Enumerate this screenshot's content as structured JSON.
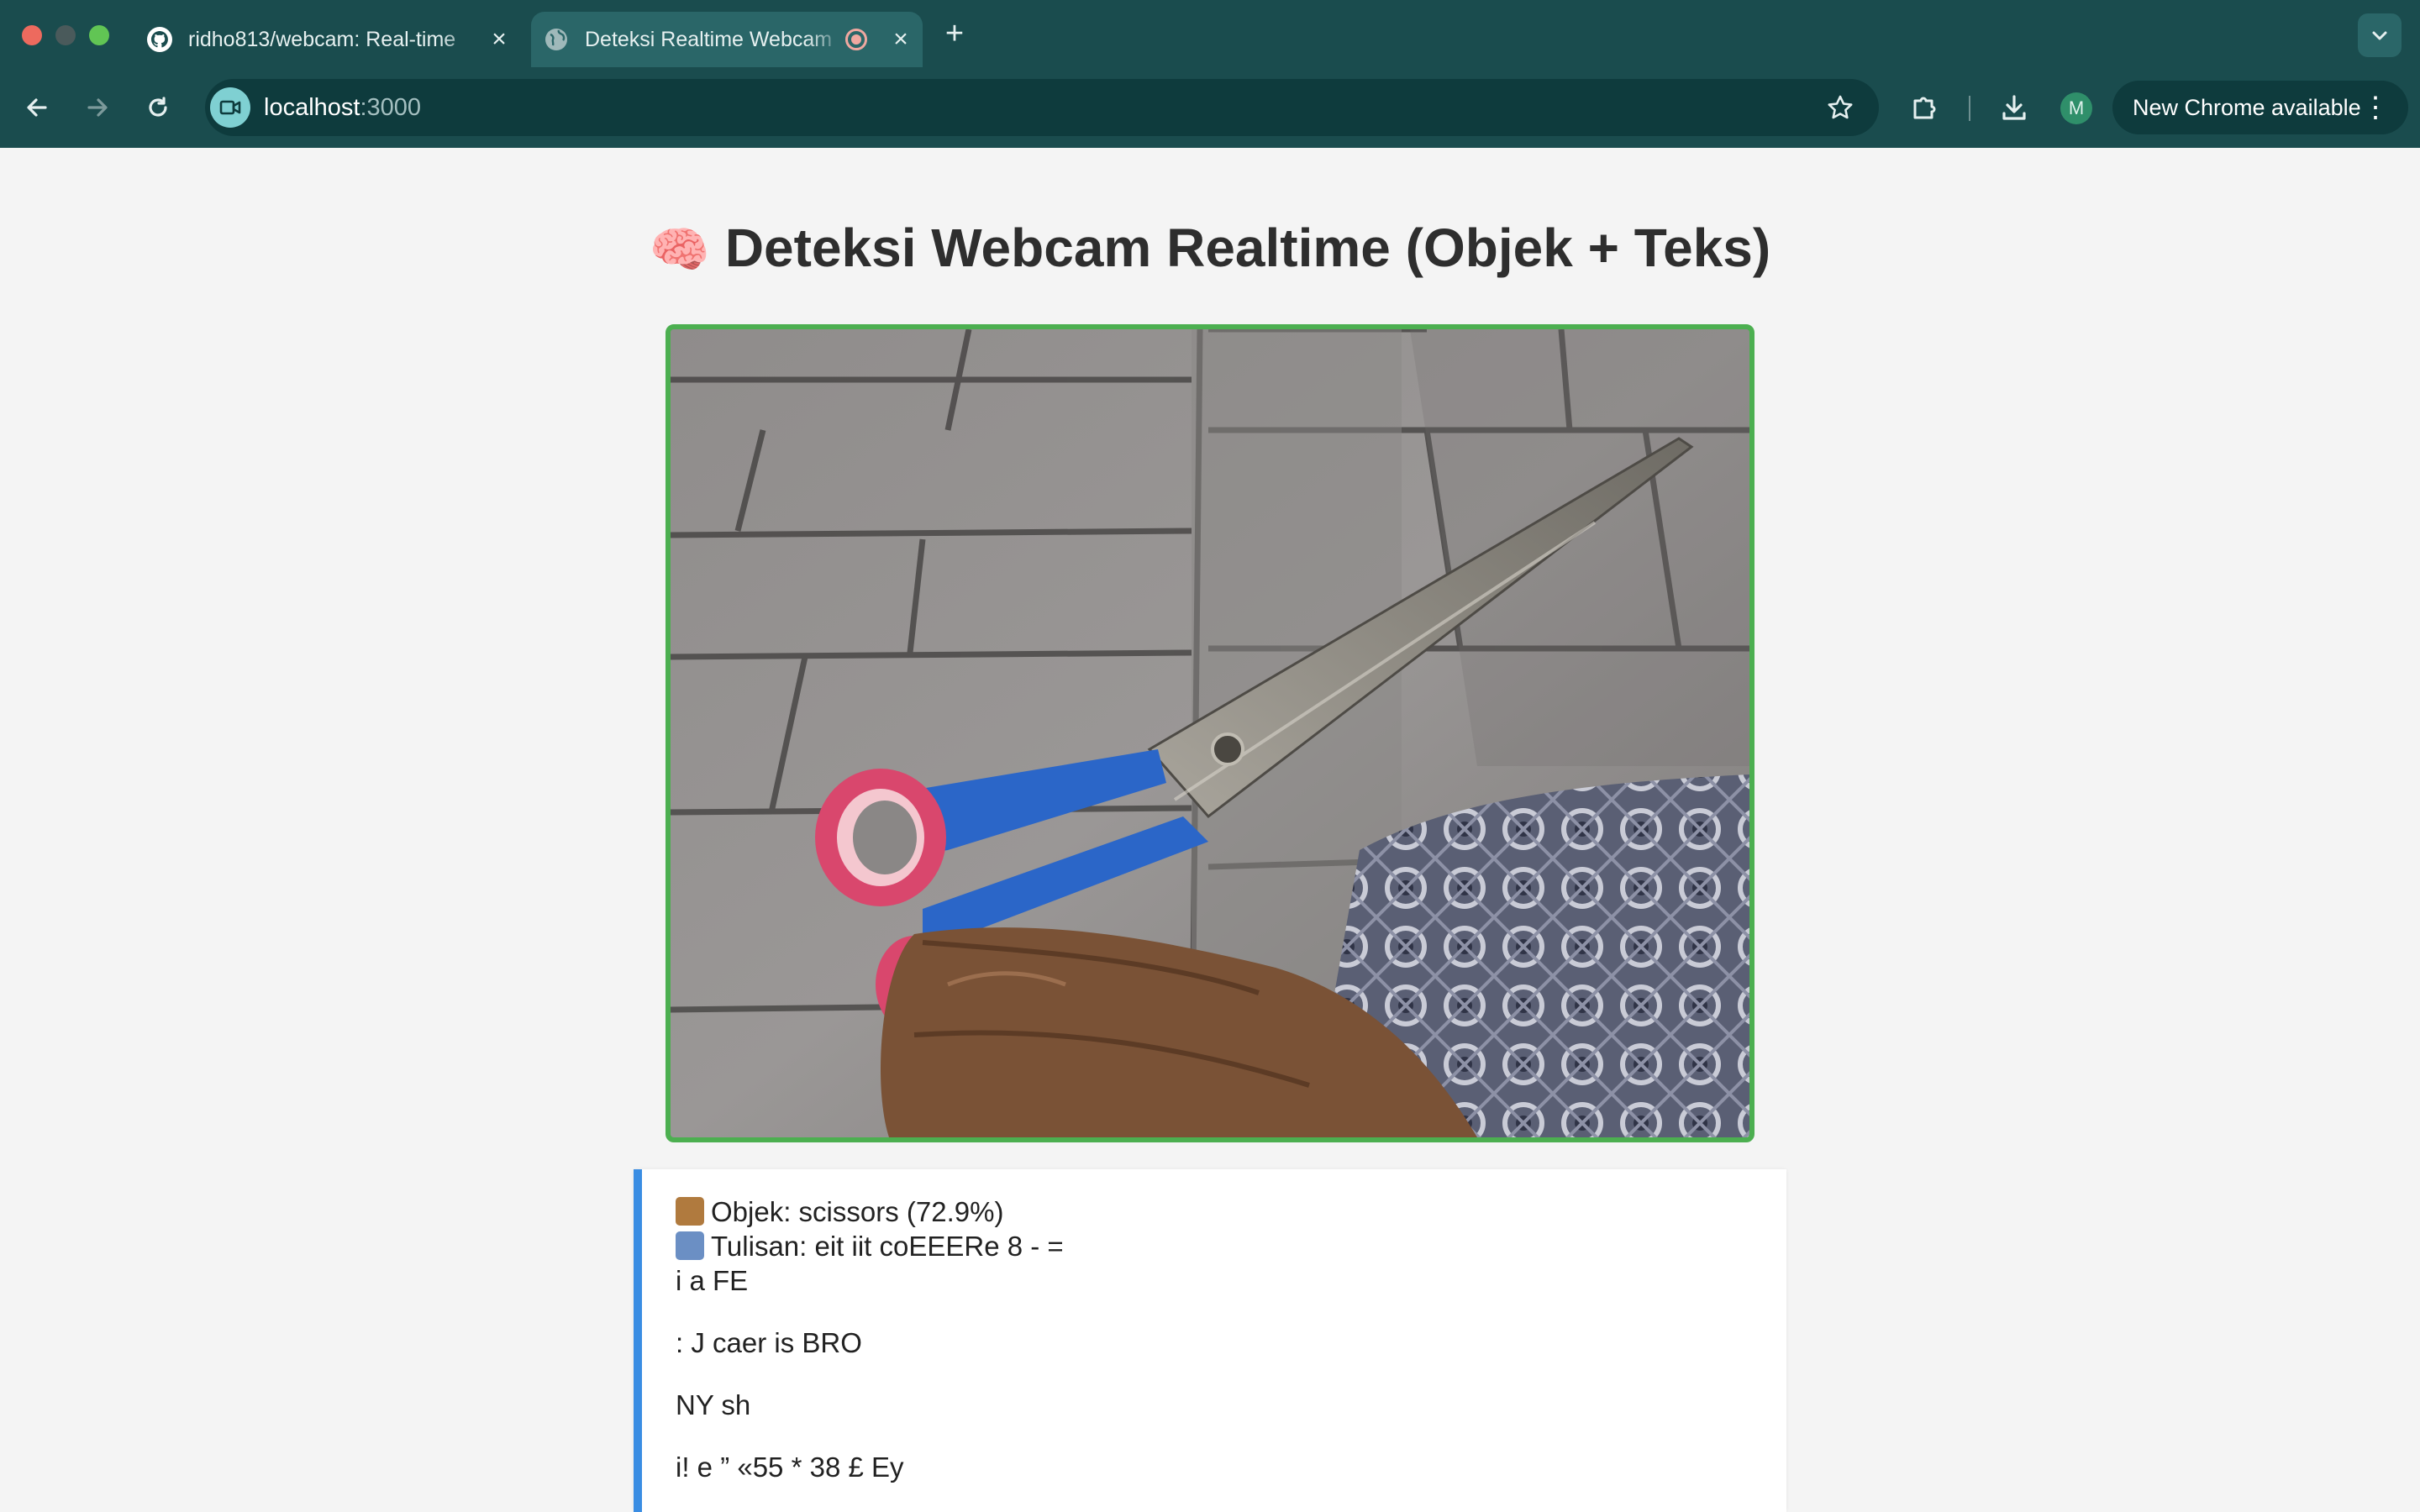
{
  "browser": {
    "tabs": [
      {
        "title": "ridho813/webcam: Real-time",
        "favicon": "github-icon",
        "active": false
      },
      {
        "title": "Deteksi Realtime Webcam",
        "favicon": "globe-icon",
        "active": true,
        "recording": true
      }
    ],
    "url_host": "localhost",
    "url_port": ":3000",
    "profile_initial": "M",
    "update_label": "New Chrome available",
    "colors": {
      "chrome": "#1a4c4e",
      "active_tab": "#2a6668",
      "omnibox": "#0e3b3d"
    }
  },
  "page": {
    "heading_emoji": "🧠",
    "heading": "Deteksi Webcam Realtime (Objek + Teks)",
    "video_border_color": "#4caf50",
    "result_accent": "#3a8de3",
    "results": {
      "object_line": "Objek: scissors (72.9%)",
      "text_label": "Tulisan: eit iit coEEERe 8 - =",
      "ocr_lines": [
        "i a FE",
        ": J caer is BRO",
        "NY sh",
        "i! e ” «55 * 38 £ Ey"
      ]
    }
  }
}
